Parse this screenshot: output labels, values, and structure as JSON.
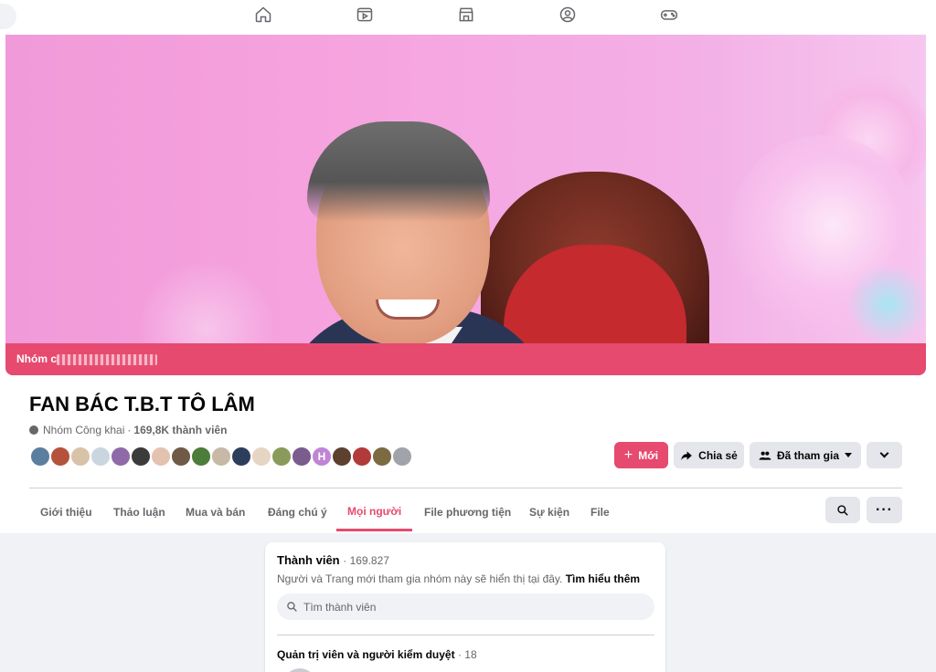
{
  "topnav": {
    "icons": [
      "home-icon",
      "video-icon",
      "marketplace-icon",
      "groups-icon",
      "gaming-icon"
    ]
  },
  "cover": {
    "label": "Nhóm của"
  },
  "group": {
    "name": "FAN BÁC T.B.T TÔ LÂM",
    "privacy": "Nhóm Công khai",
    "separator": "·",
    "members_short": "169,8K thành viên"
  },
  "avatars": {
    "count": 19,
    "colors": [
      "#5c7fa0",
      "#b4523b",
      "#d9c3a8",
      "#c9d6e0",
      "#8f6aa8",
      "#3b3b3b",
      "#e3c2b0",
      "#6f5a48",
      "#4c7d3a",
      "#c7b9a5",
      "#2d3e5c",
      "#e6d5c3",
      "#8a9a5b",
      "#7a5c8e",
      "#c084d6",
      "#5e4030",
      "#b23a3a",
      "#7c6a40",
      "#a0a4aa",
      "#5a3d32"
    ],
    "letter_avatar": "H"
  },
  "actions": {
    "new_label": "Mới",
    "share_label": "Chia sẻ",
    "joined_label": "Đã tham gia",
    "accent": "#e64a6e"
  },
  "tabs": [
    {
      "label": "Giới thiệu"
    },
    {
      "label": "Thảo luận"
    },
    {
      "label": "Mua và bán"
    },
    {
      "label": "Đáng chú ý"
    },
    {
      "label": "Mọi người"
    },
    {
      "label": "File phương tiện"
    },
    {
      "label": "Sự kiện"
    },
    {
      "label": "File"
    }
  ],
  "members": {
    "title": "Thành viên",
    "count_text": "· 169.827",
    "desc": "Người và Trang mới tham gia nhóm này sẽ hiển thị tại đây.",
    "learn_more": "Tìm hiểu thêm",
    "search_placeholder": "Tìm thành viên",
    "admins_title": "Quản trị viên và người kiểm duyệt",
    "admins_count": "· 18"
  }
}
